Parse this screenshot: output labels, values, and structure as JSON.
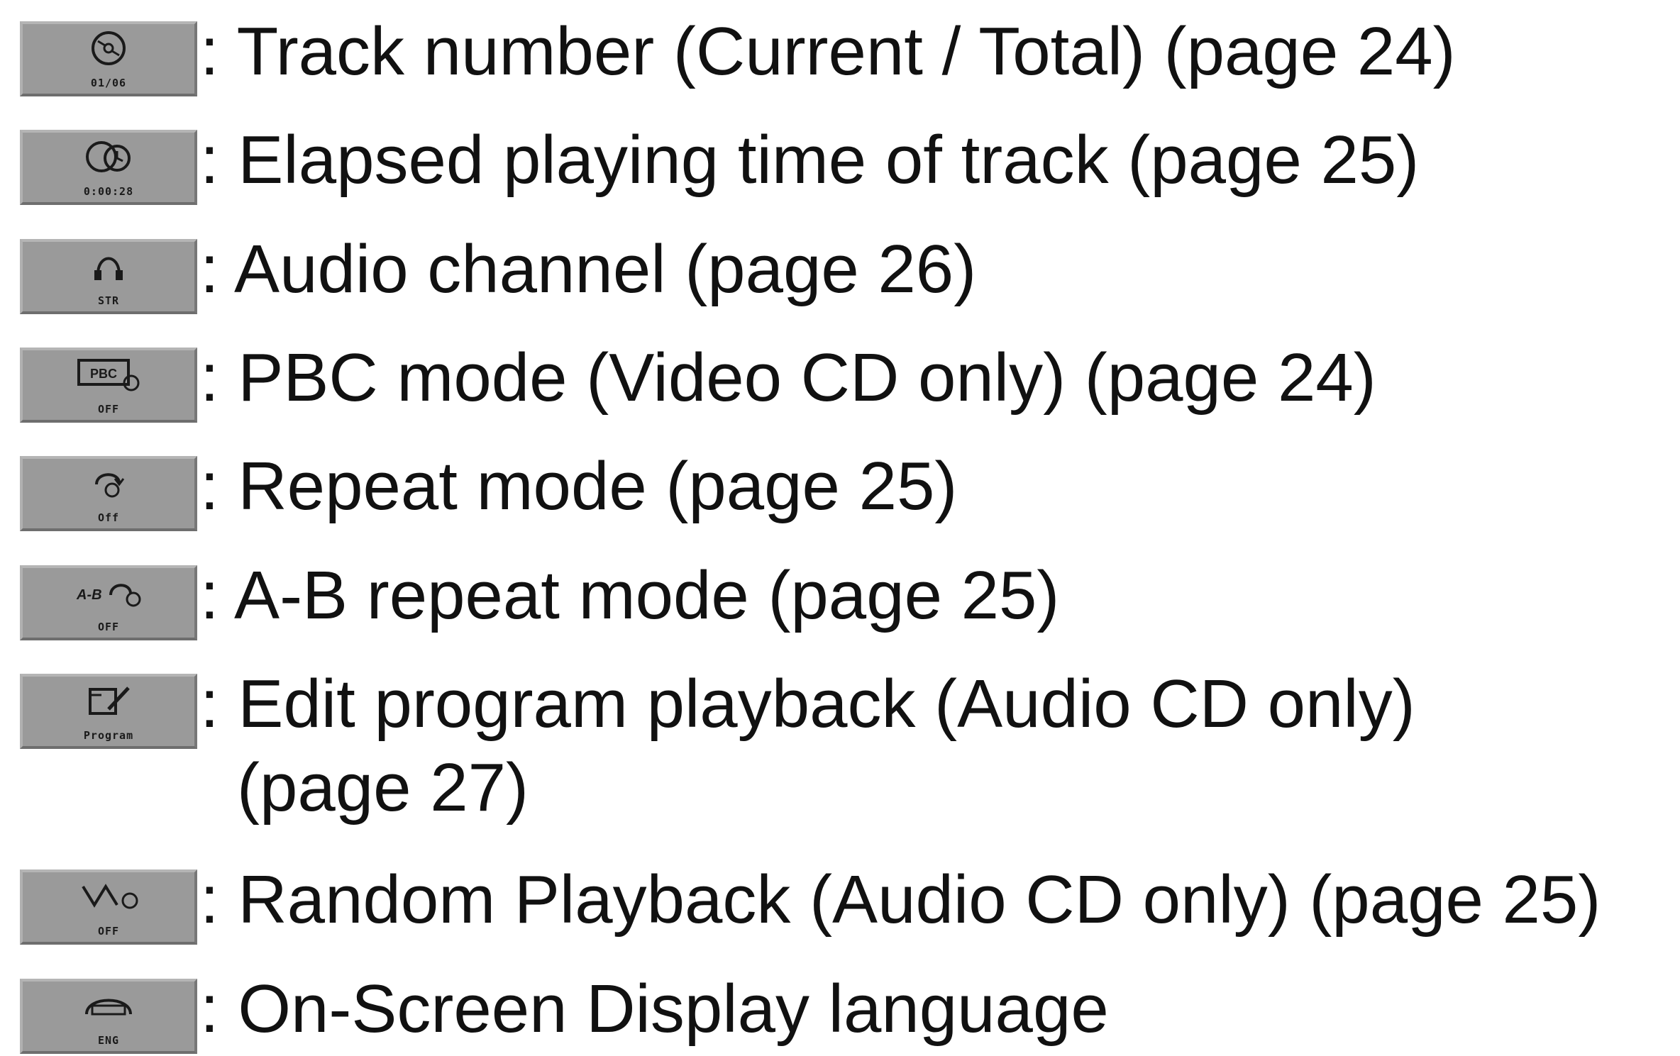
{
  "items": [
    {
      "icon_name": "track-disc-icon",
      "icon_caption": "01/06",
      "label": ": Track number (Current / Total) (page 24)"
    },
    {
      "icon_name": "elapsed-time-disc-icon",
      "icon_caption": "0:00:28",
      "label": ": Elapsed playing time of track (page 25)"
    },
    {
      "icon_name": "audio-channel-icon",
      "icon_caption": "STR",
      "label": ": Audio channel (page 26)"
    },
    {
      "icon_name": "pbc-mode-icon",
      "icon_caption": "OFF",
      "icon_inner": "PBC",
      "label": ": PBC mode (Video CD only) (page 24)"
    },
    {
      "icon_name": "repeat-mode-icon",
      "icon_caption": "Off",
      "label": ": Repeat mode (page 25)"
    },
    {
      "icon_name": "ab-repeat-icon",
      "icon_caption": "OFF",
      "label": ": A-B repeat mode (page 25)"
    },
    {
      "icon_name": "program-edit-icon",
      "icon_caption": "Program",
      "label": ": Edit program playback (Audio CD only)",
      "label_line2": "(page 27)"
    },
    {
      "icon_name": "random-playback-icon",
      "icon_caption": "OFF",
      "label": ": Random Playback (Audio CD only) (page 25)"
    },
    {
      "icon_name": "osd-language-icon",
      "icon_caption": "ENG",
      "label": ": On-Screen Display language"
    }
  ],
  "colors": {
    "icon_background": "#9a9a9a",
    "text": "#111111",
    "page_background": "#ffffff"
  }
}
